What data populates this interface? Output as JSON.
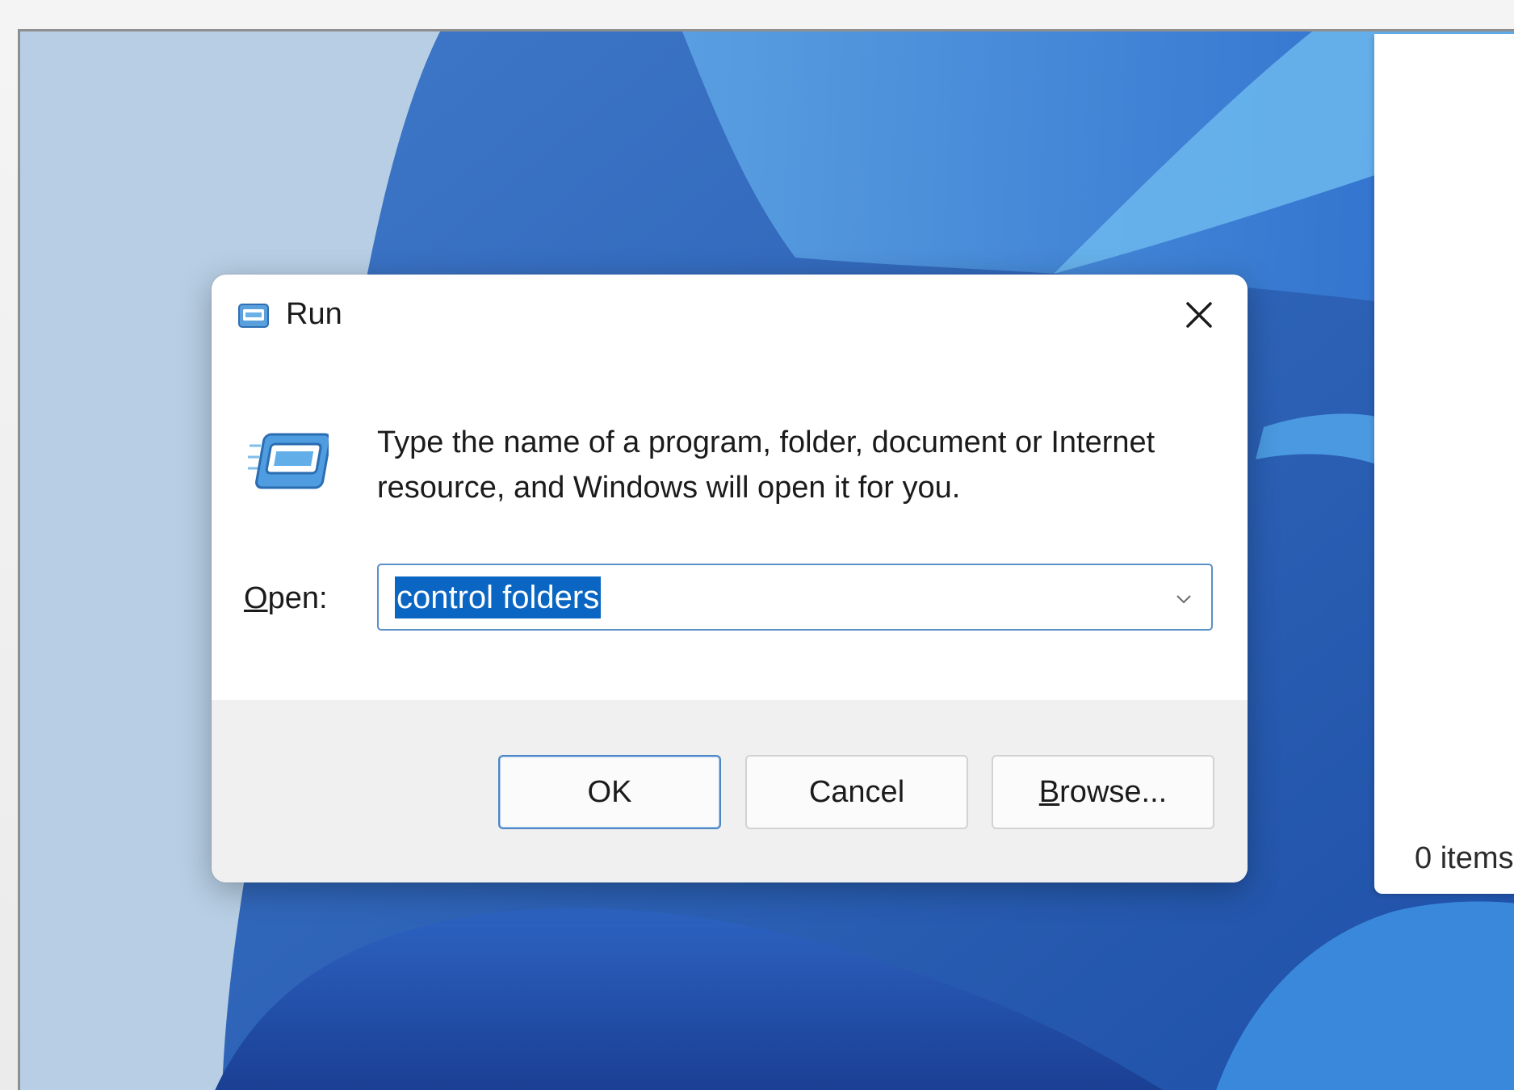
{
  "dialog": {
    "title": "Run",
    "description": "Type the name of a program, folder, document or Internet resource, and Windows will open it for you.",
    "open_label_underlined": "O",
    "open_label_rest": "pen:",
    "open_value": "control folders",
    "buttons": {
      "ok": "OK",
      "cancel": "Cancel",
      "browse_underlined": "B",
      "browse_rest": "rowse..."
    }
  },
  "explorer": {
    "status_text": "0 items"
  },
  "colors": {
    "accent": "#0a66c2",
    "input_border": "#5b8fc7",
    "footer_bg": "#f0f0f0"
  },
  "icons": {
    "title": "run-app-icon",
    "large": "run-app-icon",
    "close": "close-icon",
    "dropdown": "chevron-down-icon"
  }
}
